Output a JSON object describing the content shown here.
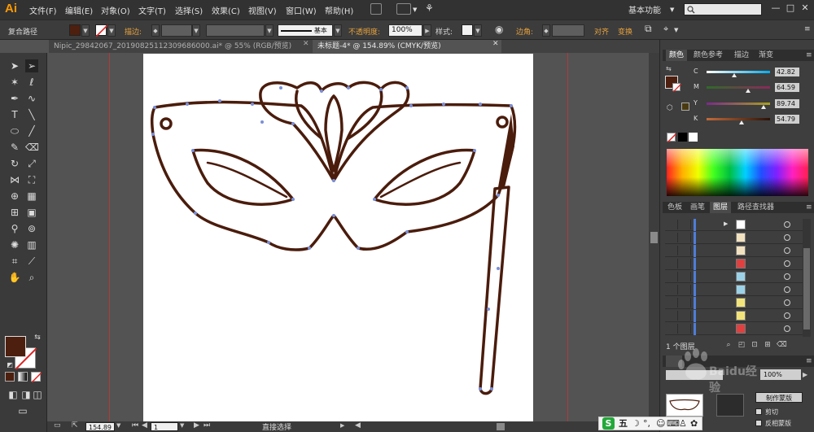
{
  "app": {
    "logo": "Ai"
  },
  "menubar": {
    "items": [
      "文件(F)",
      "编辑(E)",
      "对象(O)",
      "文字(T)",
      "选择(S)",
      "效果(C)",
      "视图(V)",
      "窗口(W)",
      "帮助(H)"
    ],
    "workspace": "基本功能",
    "window_controls": [
      "—",
      "□",
      "✕"
    ]
  },
  "controlbar": {
    "selection_label": "复合路径",
    "stroke_label": "描边:",
    "stroke_style": "基本",
    "opacity_label": "不透明度:",
    "opacity_value": "100%",
    "style_label": "样式:",
    "corner_label": "边角:",
    "align_label": "对齐",
    "transform_label": "变换",
    "colors": {
      "fill": "#4d1f0e",
      "stroke": "none"
    }
  },
  "tabs": [
    {
      "label": "Nipic_29842067_20190825112309686000.ai* @ 55% (RGB/预览)",
      "active": false
    },
    {
      "label": "未标题-4* @ 154.89% (CMYK/预览)",
      "active": true
    }
  ],
  "color_panel": {
    "tabs": [
      "颜色",
      "颜色参考",
      "描边",
      "渐变"
    ],
    "channels": [
      {
        "label": "C",
        "value": "42.82",
        "fraction": 0.43,
        "gradient": "linear-gradient(to right,#fff,#00aeef)"
      },
      {
        "label": "M",
        "value": "64.59",
        "fraction": 0.65,
        "gradient": "linear-gradient(to right,#2f6a2a,#8a2a5a)"
      },
      {
        "label": "Y",
        "value": "89.74",
        "fraction": 0.9,
        "gradient": "linear-gradient(to right,#7a2a8a,#a8a020)"
      },
      {
        "label": "K",
        "value": "54.79",
        "fraction": 0.55,
        "gradient": "linear-gradient(to right,#c46a3a,#2a1208)"
      }
    ]
  },
  "layers_panel": {
    "tabs": [
      "色板",
      "画笔",
      "图层",
      "路径查找器"
    ],
    "rows": [
      {
        "thumb_color": "#ffffff",
        "has_arrow": true
      },
      {
        "thumb_color": "#f3e2c0",
        "has_arrow": false
      },
      {
        "thumb_color": "#f3e2c0",
        "has_arrow": false
      },
      {
        "thumb_color": "#e04040",
        "has_arrow": false
      },
      {
        "thumb_color": "#9cd2e8",
        "has_arrow": false
      },
      {
        "thumb_color": "#9cd2e8",
        "has_arrow": false
      },
      {
        "thumb_color": "#f2e47a",
        "has_arrow": false
      },
      {
        "thumb_color": "#f2e47a",
        "has_arrow": false
      },
      {
        "thumb_color": "#e04040",
        "has_arrow": false
      }
    ],
    "footer": "1 个图层"
  },
  "transparency_panel": {
    "opacity_value": "100%",
    "make_mask_label": "制作蒙版",
    "clip_label": "剪切",
    "invert_mask_label": "反相蒙版"
  },
  "statusbar": {
    "zoom": "154.89",
    "page": "1",
    "tool_name": "直接选择"
  },
  "ime": {
    "logo": "S",
    "mode": "五"
  },
  "watermark": "Baidu经验"
}
